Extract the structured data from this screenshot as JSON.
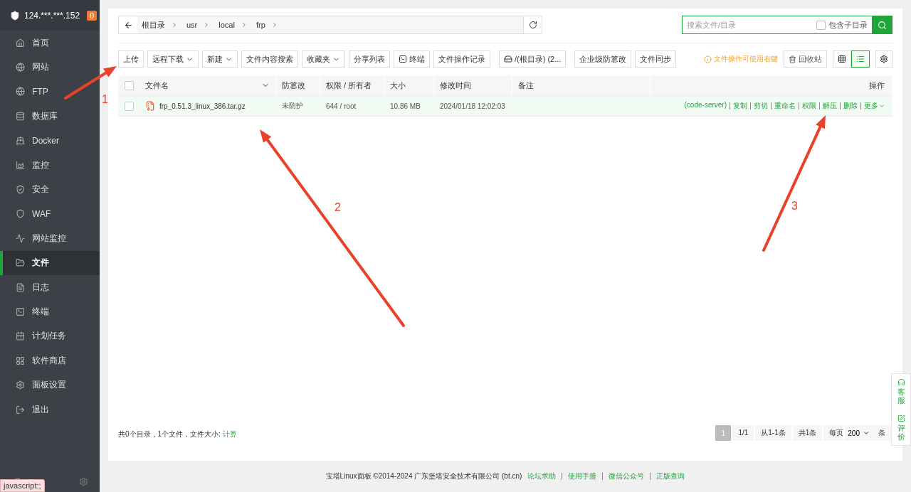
{
  "sidebar": {
    "host": "124.***.***.152",
    "badge": "0",
    "items": [
      {
        "label": "首页",
        "selected": false
      },
      {
        "label": "网站",
        "selected": false
      },
      {
        "label": "FTP",
        "selected": false
      },
      {
        "label": "数据库",
        "selected": false
      },
      {
        "label": "Docker",
        "selected": false
      },
      {
        "label": "监控",
        "selected": false
      },
      {
        "label": "安全",
        "selected": false
      },
      {
        "label": "WAF",
        "selected": false
      },
      {
        "label": "网站监控",
        "selected": false
      },
      {
        "label": "文件",
        "selected": true
      },
      {
        "label": "日志",
        "selected": false
      },
      {
        "label": "终端",
        "selected": false
      },
      {
        "label": "计划任务",
        "selected": false
      },
      {
        "label": "软件商店",
        "selected": false
      },
      {
        "label": "面板设置",
        "selected": false
      },
      {
        "label": "退出",
        "selected": false
      }
    ],
    "status_tip": "javascript:;"
  },
  "breadcrumb": [
    "根目录",
    "usr",
    "local",
    "frp"
  ],
  "search": {
    "placeholder": "搜索文件/目录",
    "subdir_label": "包含子目录",
    "subdir_checked": false
  },
  "toolbar": [
    {
      "label": "上传",
      "kind": "plain"
    },
    {
      "label": "远程下载",
      "kind": "dropdown"
    },
    {
      "label": "新建",
      "kind": "dropdown"
    },
    {
      "label": "文件内容搜索",
      "kind": "plain"
    },
    {
      "label": "收藏夹",
      "kind": "dropdown"
    },
    {
      "label": "分享列表",
      "kind": "plain"
    },
    {
      "label": "终端",
      "kind": "terminal"
    },
    {
      "label": "文件操作记录",
      "kind": "plain"
    },
    {
      "label": "/(根目录) (2...",
      "kind": "disk"
    },
    {
      "label": "企业级防篡改",
      "kind": "plain"
    },
    {
      "label": "文件同步",
      "kind": "plain"
    }
  ],
  "hint": "文件操作可使用右键",
  "recycle": "回收站",
  "view_modes": [
    {
      "selected": false
    },
    {
      "selected": true
    }
  ],
  "table": {
    "select_all_checked": false,
    "columns": [
      "文件名",
      "防篡改",
      "权限 / 所有者",
      "大小",
      "修改时间",
      "备注",
      "操作"
    ],
    "rows": [
      {
        "checked": false,
        "name": "frp_0.51.3_linux_386.tar.gz",
        "protect": "未防护",
        "perm": "644 / root",
        "size": "10.86 MB",
        "mtime": "2024/01/18 12:02:03",
        "tag": "(code-server)",
        "actions": [
          "复制",
          "剪切",
          "重命名",
          "权限",
          "解压",
          "删除",
          "更多"
        ]
      }
    ]
  },
  "summary": {
    "text": "共0个目录，1个文件，文件大小:",
    "link": "计算"
  },
  "pagination": {
    "pages": [
      {
        "label": "1",
        "selected": true
      }
    ],
    "info": [
      "1/1",
      "从1-1条",
      "共1条"
    ],
    "per_page_label": "每页",
    "per_page": "200",
    "unit": "条"
  },
  "footer": {
    "copyright": "宝塔Linux面板 ©2014-2024 广东堡塔安全技术有限公司 (bt.cn)",
    "links": [
      "论坛求助",
      "使用手册",
      "微信公众号",
      "正版查询"
    ]
  },
  "float_widget": [
    "客服",
    "评价"
  ],
  "annotations": [
    {
      "label": "1"
    },
    {
      "label": "2"
    },
    {
      "label": "3"
    }
  ]
}
